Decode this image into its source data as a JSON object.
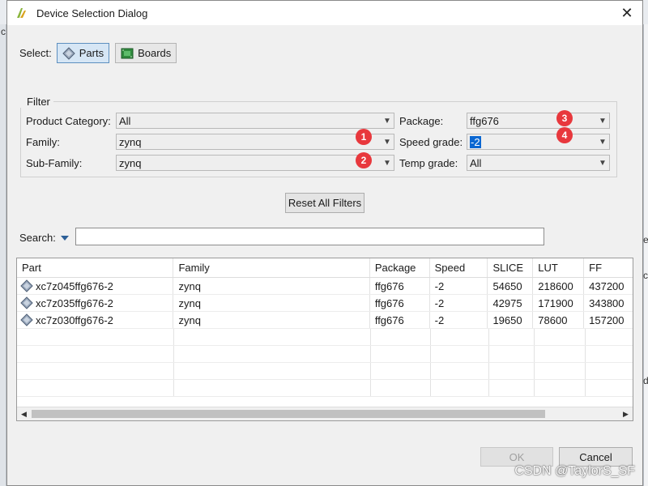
{
  "window": {
    "title": "Device Selection Dialog"
  },
  "select": {
    "label": "Select:",
    "parts_label": "Parts",
    "boards_label": "Boards"
  },
  "filter": {
    "title": "Filter",
    "product_category": {
      "label": "Product Category:",
      "value": "All"
    },
    "family": {
      "label": "Family:",
      "value": "zynq"
    },
    "sub_family": {
      "label": "Sub-Family:",
      "value": "zynq"
    },
    "package": {
      "label": "Package:",
      "value": "ffg676"
    },
    "speed_grade": {
      "label": "Speed grade:",
      "value": "-2"
    },
    "temp_grade": {
      "label": "Temp grade:",
      "value": "All"
    },
    "reset_label": "Reset All Filters"
  },
  "annotations": [
    "1",
    "2",
    "3",
    "4"
  ],
  "search": {
    "label": "Search:",
    "value": ""
  },
  "table": {
    "columns": [
      "Part",
      "Family",
      "Package",
      "Speed",
      "SLICE",
      "LUT",
      "FF"
    ],
    "rows": [
      [
        "xc7z045ffg676-2",
        "zynq",
        "ffg676",
        "-2",
        "54650",
        "218600",
        "437200"
      ],
      [
        "xc7z035ffg676-2",
        "zynq",
        "ffg676",
        "-2",
        "42975",
        "171900",
        "343800"
      ],
      [
        "xc7z030ffg676-2",
        "zynq",
        "ffg676",
        "-2",
        "19650",
        "78600",
        "157200"
      ]
    ]
  },
  "buttons": {
    "ok": "OK",
    "cancel": "Cancel"
  },
  "watermark": "CSDN @TaylorS_SF",
  "background": {
    "left_glyph": "c",
    "right_glyph_1": "e",
    "right_glyph_2": "ct",
    "right_glyph_3": "de"
  },
  "colors": {
    "accent": "#0a67d2",
    "badge": "#e8383d",
    "active_toggle": "#d6e6f5"
  }
}
